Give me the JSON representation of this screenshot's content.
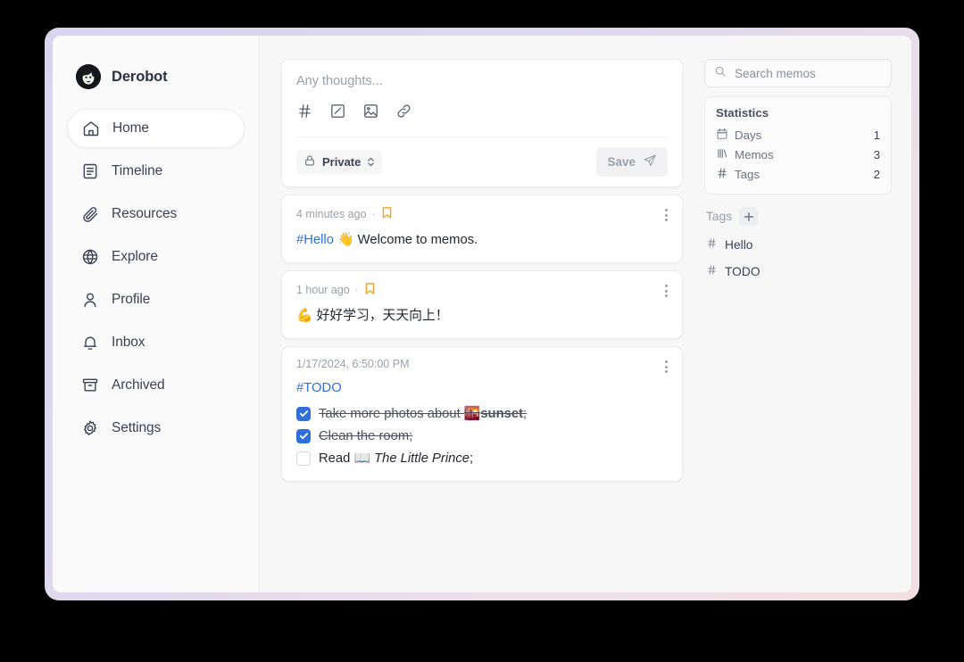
{
  "brand": {
    "name": "Derobot",
    "avatar_icon": "user-avatar"
  },
  "sidebar": {
    "items": [
      {
        "label": "Home",
        "icon": "home-icon",
        "active": true
      },
      {
        "label": "Timeline",
        "icon": "timeline-icon",
        "active": false
      },
      {
        "label": "Resources",
        "icon": "paperclip-icon",
        "active": false
      },
      {
        "label": "Explore",
        "icon": "globe-icon",
        "active": false
      },
      {
        "label": "Profile",
        "icon": "user-icon",
        "active": false
      },
      {
        "label": "Inbox",
        "icon": "bell-icon",
        "active": false
      },
      {
        "label": "Archived",
        "icon": "archive-icon",
        "active": false
      },
      {
        "label": "Settings",
        "icon": "gear-icon",
        "active": false
      }
    ]
  },
  "editor": {
    "placeholder": "Any thoughts...",
    "tools": [
      "hash-icon",
      "checkbox-icon",
      "image-icon",
      "link-icon"
    ],
    "visibility": "Private",
    "visibility_icon": "lock-icon",
    "save_label": "Save",
    "save_icon": "send-icon"
  },
  "memos": [
    {
      "time": "4 minutes ago",
      "separator": "·",
      "pinned_icon": "bookmark-icon",
      "tag": "#Hello",
      "emoji": "👋",
      "text": "Welcome to memos."
    },
    {
      "time": "1 hour ago",
      "separator": "·",
      "pinned_icon": "bookmark-icon",
      "emoji": "💪",
      "text": "好好学习，天天向上！"
    },
    {
      "time": "1/17/2024, 6:50:00 PM",
      "tag": "#TODO",
      "tasks": [
        {
          "checked": true,
          "prefix": "Take more photos about ",
          "emoji": "🌇",
          "bold": "sunset",
          "suffix": ";"
        },
        {
          "checked": true,
          "prefix": "Clean the room;",
          "emoji": "",
          "bold": "",
          "suffix": ""
        },
        {
          "checked": false,
          "prefix": "Read ",
          "emoji": "📖",
          "italic": "The Little Prince",
          "suffix": ";"
        }
      ]
    }
  ],
  "search": {
    "placeholder": "Search memos",
    "icon": "search-icon"
  },
  "statistics": {
    "title": "Statistics",
    "rows": [
      {
        "label": "Days",
        "value": "1",
        "icon": "calendar-icon"
      },
      {
        "label": "Memos",
        "value": "3",
        "icon": "library-icon"
      },
      {
        "label": "Tags",
        "value": "2",
        "icon": "hash-icon"
      }
    ]
  },
  "tags": {
    "header": "Tags",
    "add_icon": "plus-icon",
    "items": [
      {
        "hash": "#",
        "label": "Hello"
      },
      {
        "hash": "#",
        "label": "TODO"
      }
    ]
  },
  "colors": {
    "accent_blue": "#2f6fdb",
    "bookmark_amber": "#f0a633",
    "frame": "#d9d5ef"
  }
}
